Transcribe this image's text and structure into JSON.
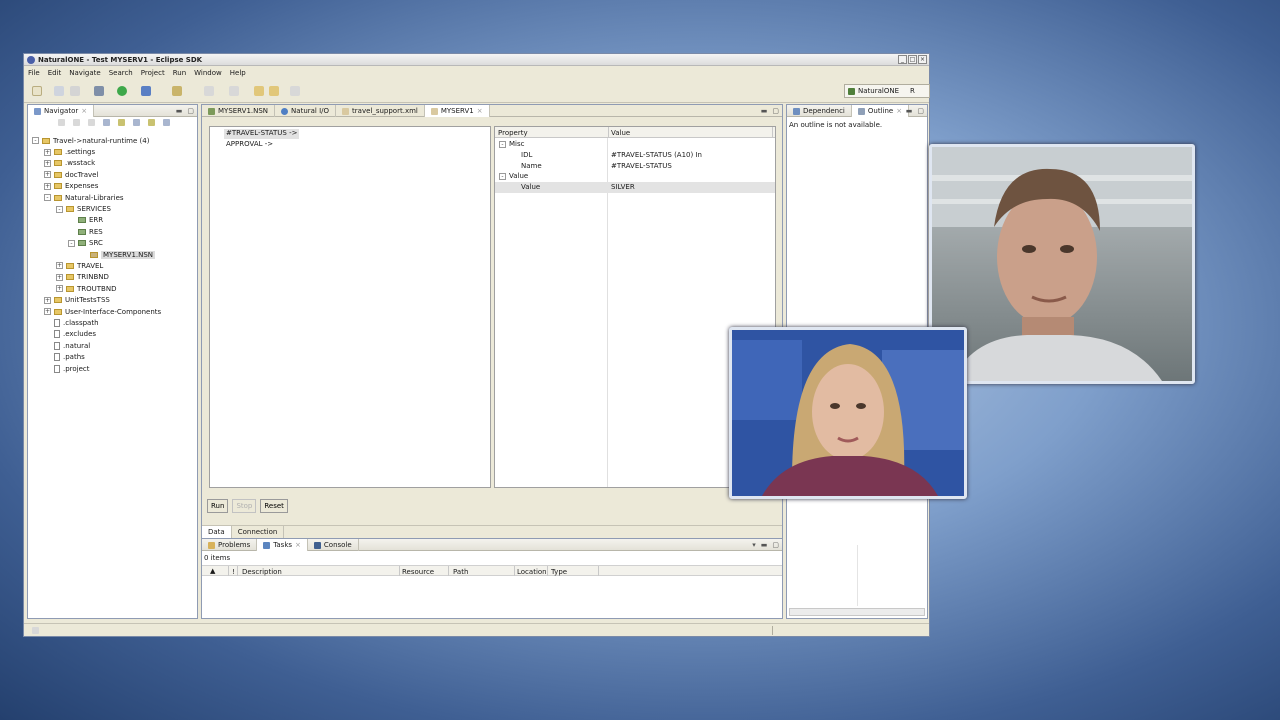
{
  "window": {
    "title": "NaturalONE - Test MYSERV1 - Eclipse SDK",
    "min": "_",
    "max": "□",
    "close": "×"
  },
  "menu": [
    "File",
    "Edit",
    "Navigate",
    "Search",
    "Project",
    "Run",
    "Window",
    "Help"
  ],
  "perspective": {
    "label": "NaturalONE",
    "more": "R"
  },
  "navigator": {
    "tab": "Navigator",
    "items": [
      {
        "label": "Travel->natural-runtime (4)",
        "depth": 0,
        "exp": "-",
        "kind": "proj"
      },
      {
        "label": ".settings",
        "depth": 1,
        "exp": "+",
        "kind": "folder"
      },
      {
        "label": ".wsstack",
        "depth": 1,
        "exp": "+",
        "kind": "folder"
      },
      {
        "label": "docTravel",
        "depth": 1,
        "exp": "+",
        "kind": "folder"
      },
      {
        "label": "Expenses",
        "depth": 1,
        "exp": "+",
        "kind": "folder"
      },
      {
        "label": "Natural-Libraries",
        "depth": 1,
        "exp": "-",
        "kind": "folder"
      },
      {
        "label": "SERVICES",
        "depth": 2,
        "exp": "-",
        "kind": "folder"
      },
      {
        "label": "ERR",
        "depth": 3,
        "exp": "",
        "kind": "lib"
      },
      {
        "label": "RES",
        "depth": 3,
        "exp": "",
        "kind": "lib"
      },
      {
        "label": "SRC",
        "depth": 3,
        "exp": "-",
        "kind": "lib"
      },
      {
        "label": "MYSERV1.NSN",
        "depth": 4,
        "exp": "",
        "kind": "nsn",
        "selected": true
      },
      {
        "label": "TRAVEL",
        "depth": 2,
        "exp": "+",
        "kind": "folder"
      },
      {
        "label": "TRINBND",
        "depth": 2,
        "exp": "+",
        "kind": "folder"
      },
      {
        "label": "TROUTBND",
        "depth": 2,
        "exp": "+",
        "kind": "folder"
      },
      {
        "label": "UnitTestsTSS",
        "depth": 1,
        "exp": "+",
        "kind": "folder"
      },
      {
        "label": "User-Interface-Components",
        "depth": 1,
        "exp": "+",
        "kind": "folder"
      },
      {
        "label": ".classpath",
        "depth": 1,
        "exp": "",
        "kind": "file"
      },
      {
        "label": ".excludes",
        "depth": 1,
        "exp": "",
        "kind": "file"
      },
      {
        "label": ".natural",
        "depth": 1,
        "exp": "",
        "kind": "file"
      },
      {
        "label": ".paths",
        "depth": 1,
        "exp": "",
        "kind": "file"
      },
      {
        "label": ".project",
        "depth": 1,
        "exp": "",
        "kind": "file"
      }
    ]
  },
  "editor_tabs": [
    {
      "label": "MYSERV1.NSN",
      "active": false
    },
    {
      "label": "Natural I/O",
      "active": false
    },
    {
      "label": "travel_support.xml",
      "active": false
    },
    {
      "label": "MYSERV1",
      "active": true,
      "close": "×"
    }
  ],
  "editor_tree": [
    "#TRAVEL-STATUS ->",
    "APPROVAL ->"
  ],
  "properties": {
    "headers": [
      "Property",
      "Value"
    ],
    "rows": [
      {
        "prop": "Misc",
        "value": "",
        "group": true
      },
      {
        "prop": "IDL",
        "value": "#TRAVEL-STATUS  (A10) In",
        "group": false
      },
      {
        "prop": "Name",
        "value": "#TRAVEL-STATUS",
        "group": false
      },
      {
        "prop": "Value",
        "value": "",
        "group": true
      },
      {
        "prop": "Value",
        "value": "SILVER",
        "group": false,
        "selected": true
      }
    ]
  },
  "buttons": {
    "run": "Run",
    "stop": "Stop",
    "reset": "Reset"
  },
  "bottom_tabs": [
    "Data",
    "Connection"
  ],
  "tasks": {
    "tabs": [
      "Problems",
      "Tasks",
      "Console"
    ],
    "count": "0 items",
    "columns": [
      "!",
      "Description",
      "Resource",
      "Path",
      "Location",
      "Type"
    ]
  },
  "outline": {
    "tabs": [
      "Dependenci",
      "Outline"
    ],
    "message": "An outline is not available."
  },
  "colors": {
    "selection": "#dcdcdc",
    "panel_border": "#8f9bb3",
    "chrome": "#ece9d8"
  }
}
